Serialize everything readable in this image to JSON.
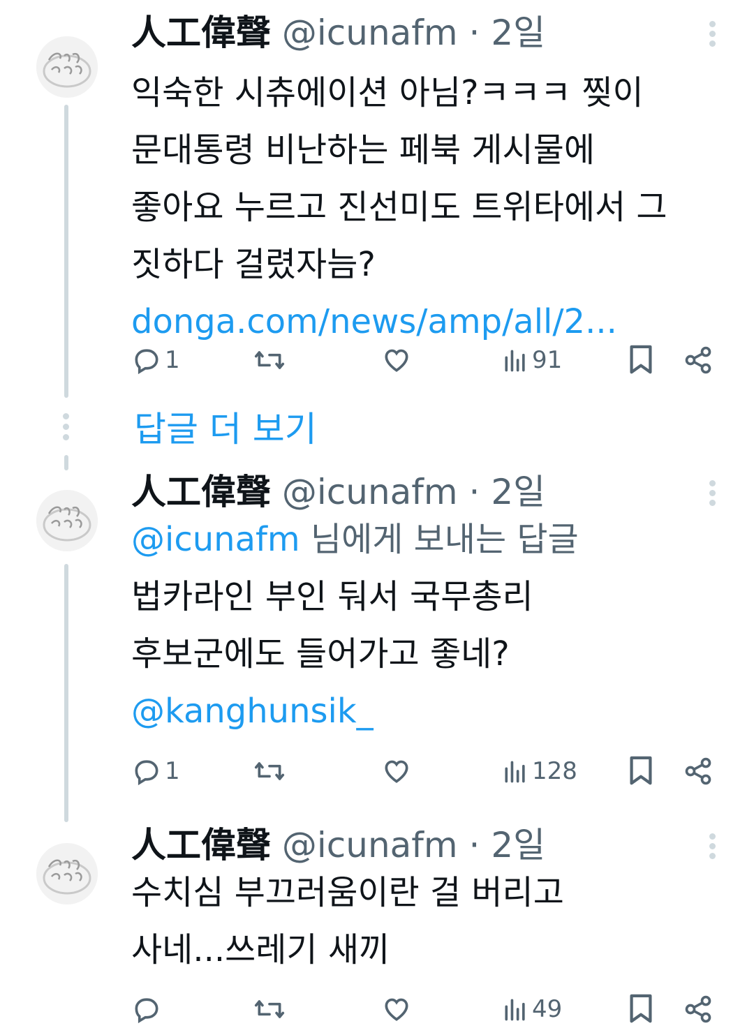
{
  "tweets": [
    {
      "name": "人工偉聲",
      "handle": "@icunafm",
      "dot": "·",
      "time": "2일",
      "reply_to_handle": "",
      "reply_to_suffix": "",
      "lines": [
        "익숙한 시츄에이션 아님?ㅋㅋㅋ 찢이",
        "문대통령 비난하는 페북 게시물에",
        "좋아요 누르고 진선미도 트위타에서 그",
        "짓하다 걸렸자늠?"
      ],
      "link": "donga.com/news/amp/all/2...",
      "replies": "1",
      "retweets": "",
      "likes": "",
      "views": "91"
    },
    {
      "name": "人工偉聲",
      "handle": "@icunafm",
      "dot": "·",
      "time": "2일",
      "reply_to_handle": "@icunafm",
      "reply_to_suffix": "님에게 보내는 답글",
      "lines": [
        "법카라인 부인 둬서 국무총리",
        "후보군에도 들어가고 좋네?"
      ],
      "link": "@kanghunsik_",
      "replies": "1",
      "retweets": "",
      "likes": "",
      "views": "128"
    },
    {
      "name": "人工偉聲",
      "handle": "@icunafm",
      "dot": "·",
      "time": "2일",
      "reply_to_handle": "",
      "reply_to_suffix": "",
      "lines": [
        "수치심 부끄러움이란 걸 버리고",
        "사네...쓰레기 새끼"
      ],
      "link": "",
      "replies": "",
      "retweets": "",
      "likes": "",
      "views": "49"
    }
  ],
  "show_more_replies": "답글 더 보기",
  "icons": {
    "reply": "reply-icon",
    "retweet": "retweet-icon",
    "like": "heart-icon",
    "views": "views-icon",
    "bookmark": "bookmark-icon",
    "share": "share-icon",
    "more": "more-vertical-icon"
  },
  "colors": {
    "link": "#1d9bf0",
    "secondary": "#536471",
    "text": "#0f1419",
    "thread_line": "#cfd9de"
  }
}
